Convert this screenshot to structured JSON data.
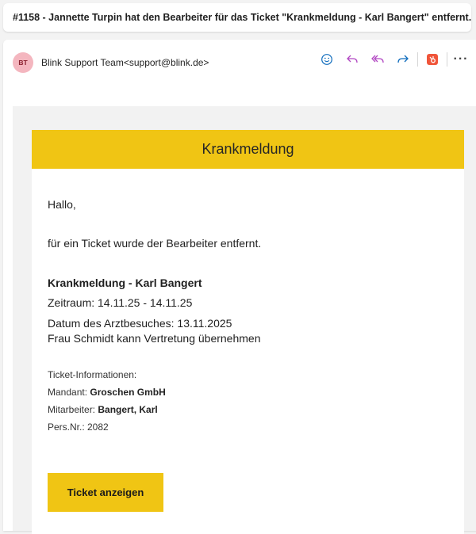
{
  "subject": "#1158 - Jannette Turpin hat den Bearbeiter für das Ticket \"Krankmeldung - Karl Bangert\" entfernt.",
  "sender": {
    "initials": "BT",
    "display": "Blink Support Team<support@blink.de>"
  },
  "actions": [
    {
      "name": "emoji-icon",
      "color": "#0f6cbd"
    },
    {
      "name": "reply-icon",
      "color": "#b146c2"
    },
    {
      "name": "reply-all-icon",
      "color": "#b146c2"
    },
    {
      "name": "forward-icon",
      "color": "#0f6cbd"
    },
    {
      "name": "hubspot-icon",
      "color": "#f0553a"
    },
    {
      "name": "more-icon",
      "color": "#424242"
    }
  ],
  "email": {
    "header_title": "Krankmeldung",
    "greeting": "Hallo,",
    "intro": "für ein Ticket wurde der Bearbeiter entfernt.",
    "ticket_title": "Krankmeldung - Karl Bangert",
    "period": "Zeitraum: 14.11.25 - 14.11.25",
    "doctor_visit": "Datum des Arztbesuches: 13.11.2025",
    "substitute": "Frau Schmidt kann Vertretung übernehmen",
    "info_heading": "Ticket-Informationen:",
    "client_label": "Mandant:",
    "client_value": "Groschen GmbH",
    "employee_label": "Mitarbeiter:",
    "employee_value": "Bangert, Karl",
    "persnr": "Pers.Nr.: 2082",
    "button_label": "Ticket anzeigen"
  },
  "colors": {
    "accent_yellow": "#f0c514",
    "avatar_bg": "#f4b6bf"
  }
}
